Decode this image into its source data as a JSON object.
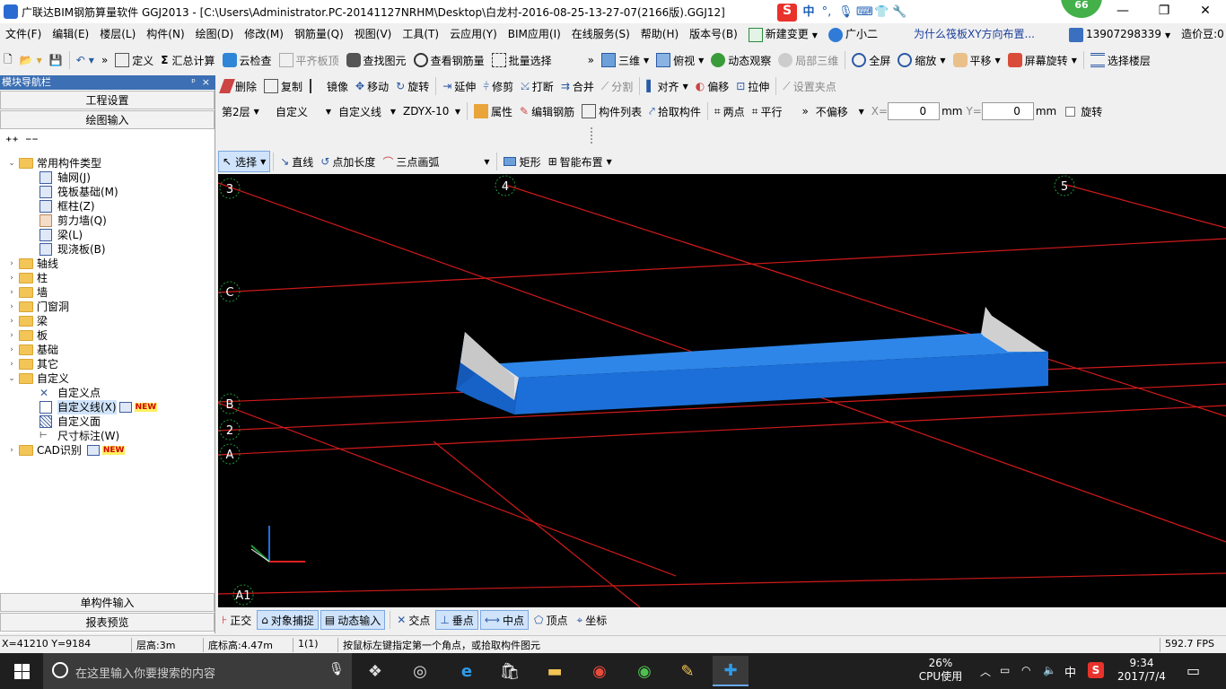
{
  "window": {
    "title": "广联达BIM钢筋算量软件 GGJ2013 - [C:\\Users\\Administrator.PC-20141127NRHM\\Desktop\\白龙村-2016-08-25-13-27-07(2166版).GGJ12]",
    "badge": "66",
    "ime": {
      "lang": "中",
      "dot": "°,"
    }
  },
  "menu": {
    "items": [
      "文件(F)",
      "编辑(E)",
      "楼层(L)",
      "构件(N)",
      "绘图(D)",
      "修改(M)",
      "钢筋量(Q)",
      "视图(V)",
      "工具(T)",
      "云应用(Y)",
      "BIM应用(I)",
      "在线服务(S)",
      "帮助(H)",
      "版本号(B)"
    ],
    "new_change": "新建变更",
    "assistant": "广小二",
    "question": "为什么筏板XY方向布置...",
    "phone": "13907298339",
    "price": "造价豆:0"
  },
  "toolbar1": {
    "define": "定义",
    "sum": "汇总计算",
    "cloud_check": "云检查",
    "align_top": "平齐板顶",
    "find": "查找图元",
    "view_rebar": "查看钢筋量",
    "batch": "批量选择",
    "three_d": "三维",
    "top_view": "俯视",
    "dyn_view": "动态观察",
    "local_3d": "局部三维",
    "fullscreen": "全屏",
    "zoom": "缩放",
    "pan": "平移",
    "rotate_screen": "屏幕旋转",
    "select_floor": "选择楼层"
  },
  "toolbar2": {
    "delete": "删除",
    "copy": "复制",
    "mirror": "镜像",
    "move": "移动",
    "rotate": "旋转",
    "extend": "延伸",
    "trim": "修剪",
    "break": "打断",
    "merge": "合并",
    "split": "分割",
    "align": "对齐",
    "offset": "偏移",
    "stretch": "拉伸",
    "set_grip": "设置夹点"
  },
  "toolbar3": {
    "floor": "第2层",
    "type": "自定义",
    "subtype": "自定义线",
    "name": "ZDYX-10",
    "props": "属性",
    "edit_rebar": "编辑钢筋",
    "comp_list": "构件列表",
    "pick": "拾取构件",
    "two_point": "两点",
    "parallel": "平行",
    "no_offset": "不偏移",
    "x_label": "X=",
    "x_value": "0",
    "y_label": "Y=",
    "y_value": "0",
    "unit": "mm",
    "rotate": "旋转"
  },
  "toolbar4": {
    "select": "选择",
    "line": "直线",
    "point_len": "点加长度",
    "arc3": "三点画弧",
    "rect": "矩形",
    "smart": "智能布置"
  },
  "left_panel": {
    "title": "模块导航栏",
    "pin": "ᵖ",
    "close": "×",
    "btn_project": "工程设置",
    "btn_draw": "绘图输入",
    "btn_single": "单构件输入",
    "btn_report": "报表预览",
    "tree": {
      "common": "常用构件类型",
      "common_items": [
        "轴网(J)",
        "筏板基础(M)",
        "框柱(Z)",
        "剪力墙(Q)",
        "梁(L)",
        "现浇板(B)"
      ],
      "folders": [
        "轴线",
        "柱",
        "墙",
        "门窗洞",
        "梁",
        "板",
        "基础",
        "其它"
      ],
      "custom": "自定义",
      "custom_items": [
        "自定义点",
        "自定义线(X)",
        "自定义面",
        "尺寸标注(W)"
      ],
      "cad": "CAD识别",
      "new_tag": "NEW"
    }
  },
  "canvas": {
    "axis_labels": [
      "3",
      "4",
      "5",
      "C",
      "B",
      "2",
      "A",
      "A1"
    ],
    "bg_color": "#000000",
    "grid_color": "#d11a1a",
    "beam_color": "#1e70dc",
    "cap_color": "#d8d8d8"
  },
  "snapbar": {
    "ortho": "正交",
    "osnap": "对象捕捉",
    "dyn_input": "动态输入",
    "intersect": "交点",
    "perp": "垂点",
    "mid": "中点",
    "vertex": "顶点",
    "coord": "坐标"
  },
  "status": {
    "coords": "X=41210 Y=9184",
    "floor_height": "层高:3m",
    "base_height": "底标高:4.47m",
    "count": "1(1)",
    "hint": "按鼠标左键指定第一个角点，或拾取构件图元",
    "fps": "592.7 FPS"
  },
  "taskbar": {
    "search_placeholder": "在这里输入你要搜索的内容",
    "cpu_pct": "26%",
    "cpu_label": "CPU使用",
    "ime": "中",
    "time": "9:34",
    "date": "2017/7/4"
  }
}
